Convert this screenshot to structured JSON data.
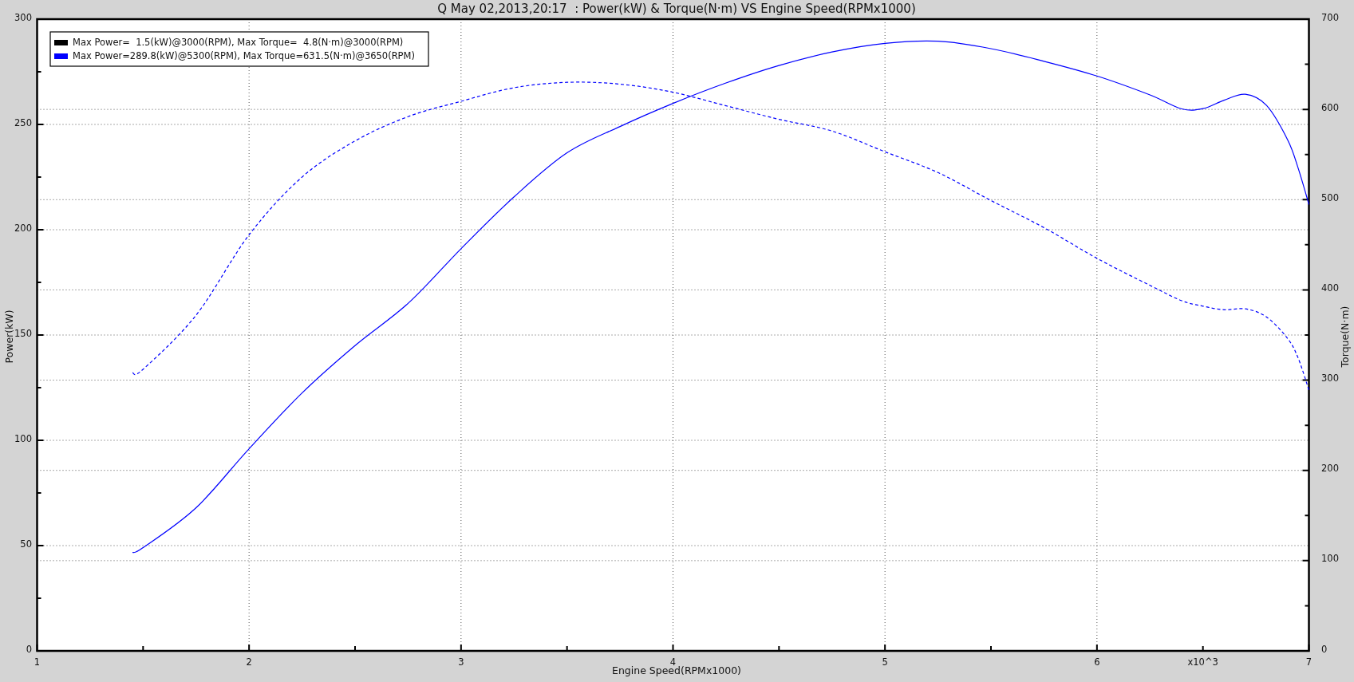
{
  "chart_data": {
    "type": "line",
    "title": "Q May 02,2013,20:17  : Power(kW) & Torque(N·m) VS Engine Speed(RPMx1000)",
    "xlabel": "Engine Speed(RPMx1000)",
    "ylabel": "Power(kW)",
    "y2label": "Torque(N·m)",
    "xlim": [
      1,
      7
    ],
    "ylim": [
      0,
      300
    ],
    "y2lim": [
      0,
      700
    ],
    "grid": true,
    "xticks": [
      1,
      2,
      3,
      4,
      5,
      6,
      {
        "value": 6.5,
        "label": "x10^3"
      },
      7
    ],
    "yticks": [
      0,
      50,
      100,
      150,
      200,
      250,
      300
    ],
    "y2ticks": [
      0,
      100,
      200,
      300,
      400,
      500,
      600,
      700
    ],
    "x": [
      1.45,
      1.5,
      1.75,
      2,
      2.25,
      2.5,
      2.75,
      3,
      3.25,
      3.5,
      3.75,
      4,
      4.25,
      4.5,
      4.75,
      5,
      5.25,
      5.5,
      5.75,
      6,
      6.25,
      6.4,
      6.5,
      6.6,
      6.7,
      6.8,
      6.9,
      6.95,
      7
    ],
    "series": [
      {
        "color": "#0000ff",
        "line_style": "solid",
        "values": [
          46.7,
          49,
          68,
          96,
          122.5,
          145,
          165,
          191,
          215.6,
          236.5,
          249,
          260,
          269.7,
          278,
          284.4,
          288.5,
          289.5,
          286,
          280,
          273,
          264,
          257.4,
          257.5,
          261.5,
          264.3,
          259,
          242.6,
          229,
          212
        ]
      },
      {
        "color": "#0000ff",
        "axis": "y2",
        "line_style": "dashed",
        "values": [
          308,
          312,
          372,
          461,
          525,
          565,
          592,
          609,
          624,
          630,
          628,
          619,
          604,
          589,
          576,
          553,
          530,
          499,
          469,
          435,
          405,
          388,
          382,
          378,
          379,
          370,
          346,
          324,
          289
        ]
      }
    ]
  },
  "legend": [
    {
      "text": "Max Power=  1.5(kW)@3000(RPM), Max Torque=  4.8(N·m)@3000(RPM)",
      "color": "#000000"
    },
    {
      "text": "Max Power=289.8(kW)@5300(RPM), Max Torque=631.5(N·m)@3650(RPM)",
      "color": "#0000ff"
    }
  ]
}
